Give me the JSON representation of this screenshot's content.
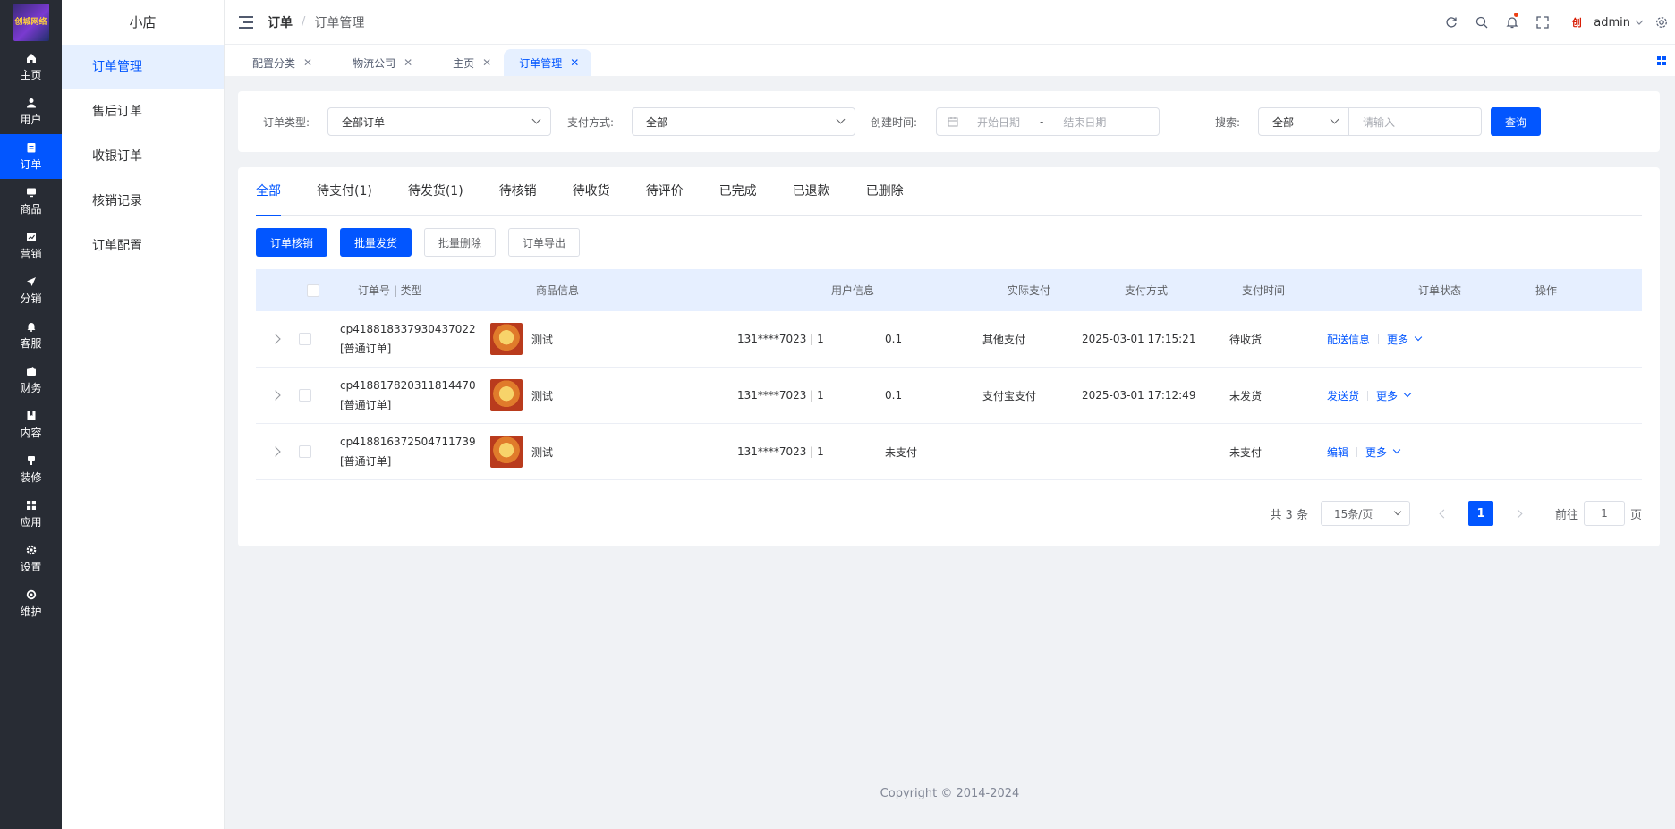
{
  "brand": {
    "logo_text": "创城网络",
    "shop_name": "小店"
  },
  "leftnav": [
    {
      "label": "主页",
      "icon": "home-icon"
    },
    {
      "label": "用户",
      "icon": "user-icon"
    },
    {
      "label": "订单",
      "icon": "order-icon",
      "active": true
    },
    {
      "label": "商品",
      "icon": "goods-icon"
    },
    {
      "label": "营销",
      "icon": "marketing-icon"
    },
    {
      "label": "分销",
      "icon": "send-icon"
    },
    {
      "label": "客服",
      "icon": "bell-icon"
    },
    {
      "label": "财务",
      "icon": "finance-icon"
    },
    {
      "label": "内容",
      "icon": "content-icon"
    },
    {
      "label": "装修",
      "icon": "brush-icon"
    },
    {
      "label": "应用",
      "icon": "apps-icon"
    },
    {
      "label": "设置",
      "icon": "gear-icon"
    },
    {
      "label": "维护",
      "icon": "maintain-icon"
    }
  ],
  "submenu": [
    {
      "label": "订单管理",
      "active": true
    },
    {
      "label": "售后订单"
    },
    {
      "label": "收银订单"
    },
    {
      "label": "核销记录"
    },
    {
      "label": "订单配置"
    }
  ],
  "header": {
    "crumb_root": "订单",
    "crumb_sep": "/",
    "crumb_current": "订单管理",
    "username": "admin",
    "avatar_text": "创",
    "has_notification_dot": true
  },
  "tabs": [
    {
      "label": "配置分类",
      "close": "✕"
    },
    {
      "label": "物流公司",
      "close": "✕"
    },
    {
      "label": "主页",
      "close": "✕"
    },
    {
      "label": "订单管理",
      "close": "✕",
      "active": true
    }
  ],
  "filters": {
    "type_label": "订单类型:",
    "type_value": "全部订单",
    "pay_label": "支付方式:",
    "pay_value": "全部",
    "time_label": "创建时间:",
    "start_placeholder": "开始日期",
    "range_sep": "-",
    "end_placeholder": "结束日期",
    "search_label": "搜索:",
    "search_scope": "全部",
    "search_placeholder": "请输入",
    "query_button": "查询"
  },
  "order_tabs": [
    "全部",
    "待支付(1)",
    "待发货(1)",
    "待核销",
    "待收货",
    "待评价",
    "已完成",
    "已退款",
    "已删除"
  ],
  "actions": {
    "verify": "订单核销",
    "ship": "批量发货",
    "delete": "批量删除",
    "export": "订单导出"
  },
  "table": {
    "columns": [
      "订单号 | 类型",
      "商品信息",
      "用户信息",
      "实际支付",
      "支付方式",
      "支付时间",
      "订单状态",
      "操作"
    ],
    "rows": [
      {
        "order_no": "cp418818337930437022",
        "type": "[普通订单]",
        "product": "测试",
        "user": "131****7023 | 1",
        "paid": "0.1",
        "pay_method": "其他支付",
        "pay_time": "2025-03-01 17:15:21",
        "status": "待收货",
        "op1": "配送信息",
        "op2": "更多"
      },
      {
        "order_no": "cp418817820311814470",
        "type": "[普通订单]",
        "product": "测试",
        "user": "131****7023 | 1",
        "paid": "0.1",
        "pay_method": "支付宝支付",
        "pay_time": "2025-03-01 17:12:49",
        "status": "未发货",
        "op1": "发送货",
        "op2": "更多"
      },
      {
        "order_no": "cp418816372504711739",
        "type": "[普通订单]",
        "product": "测试",
        "user": "131****7023 | 1",
        "paid": "未支付",
        "pay_method": "",
        "pay_time": "",
        "status": "未支付",
        "op1": "编辑",
        "op2": "更多"
      }
    ]
  },
  "pagination": {
    "total": "共 3 条",
    "page_size": "15条/页",
    "current": "1",
    "goto_label": "前往",
    "goto_value": "1",
    "page_unit": "页"
  },
  "footer": "Copyright © 2014-2024",
  "colors": {
    "primary": "#0256ff",
    "nav_bg": "#282c34",
    "header_row": "#e6efff"
  }
}
